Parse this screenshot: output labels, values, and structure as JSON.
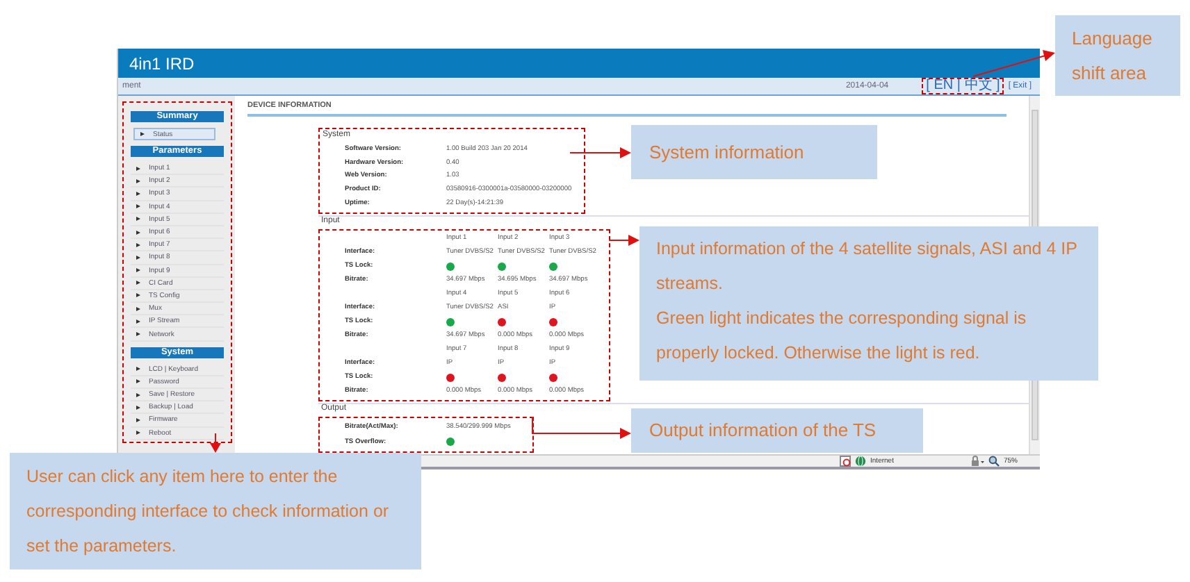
{
  "window": {
    "title": "4in1 IRD"
  },
  "nav_bar": {
    "breadcrumb": "ment",
    "date": "2014-04-04",
    "language_switch": {
      "label": "[ EN | 中文 ]",
      "highlighted": true
    },
    "exit": "[ Exit ]"
  },
  "sidebar": {
    "groups": [
      {
        "title": "Summary",
        "items": [
          {
            "label": "Status",
            "selected": true
          }
        ]
      },
      {
        "title": "Parameters",
        "items": [
          {
            "label": "Input 1",
            "selected": false
          },
          {
            "label": "Input 2",
            "selected": false
          },
          {
            "label": "Input 3",
            "selected": false
          },
          {
            "label": "Input 4",
            "selected": false
          },
          {
            "label": "Input 5",
            "selected": false
          },
          {
            "label": "Input 6",
            "selected": false
          },
          {
            "label": "Input 7",
            "selected": false
          },
          {
            "label": "Input 8",
            "selected": false
          },
          {
            "label": "Input 9",
            "selected": false
          },
          {
            "label": "CI Card",
            "selected": false
          },
          {
            "label": "TS Config",
            "selected": false
          },
          {
            "label": "Mux",
            "selected": false
          },
          {
            "label": "IP Stream",
            "selected": false
          },
          {
            "label": "Network",
            "selected": false
          }
        ]
      },
      {
        "title": "System",
        "items": [
          {
            "label": "LCD | Keyboard",
            "selected": false
          },
          {
            "label": "Password",
            "selected": false
          },
          {
            "label": "Save | Restore",
            "selected": false
          },
          {
            "label": "Backup | Load",
            "selected": false
          },
          {
            "label": "Firmware",
            "selected": false
          },
          {
            "label": "Reboot",
            "selected": false
          }
        ]
      }
    ]
  },
  "content": {
    "title": "DEVICE INFORMATION",
    "system": {
      "title": "System",
      "rows": [
        {
          "label": "Software Version:",
          "value": "1.00 Build 203 Jan 20 2014"
        },
        {
          "label": "Hardware Version:",
          "value": "0.40"
        },
        {
          "label": "Web Version:",
          "value": "1.03"
        },
        {
          "label": "Product ID:",
          "value": "03580916-0300001a-03580000-03200000"
        },
        {
          "label": "Uptime:",
          "value": "22 Day(s)-14:21:39"
        }
      ]
    },
    "input": {
      "title": "Input",
      "groups": [
        {
          "labels": [
            "Interface:",
            "TS Lock:",
            "Bitrate:"
          ],
          "inputs": [
            {
              "name": "Input 1",
              "interface": "Tuner DVBS/S2",
              "locked": true,
              "bitrate": "34.697 Mbps"
            },
            {
              "name": "Input 2",
              "interface": "Tuner DVBS/S2",
              "locked": true,
              "bitrate": "34.695 Mbps"
            },
            {
              "name": "Input 3",
              "interface": "Tuner DVBS/S2",
              "locked": true,
              "bitrate": "34.697 Mbps"
            }
          ]
        },
        {
          "labels": [
            "Interface:",
            "TS Lock:",
            "Bitrate:"
          ],
          "inputs": [
            {
              "name": "Input 4",
              "interface": "Tuner DVBS/S2",
              "locked": true,
              "bitrate": "34.697 Mbps"
            },
            {
              "name": "Input 5",
              "interface": "ASI",
              "locked": false,
              "bitrate": "0.000 Mbps"
            },
            {
              "name": "Input 6",
              "interface": "IP",
              "locked": false,
              "bitrate": "0.000 Mbps"
            }
          ]
        },
        {
          "labels": [
            "Interface:",
            "TS Lock:",
            "Bitrate:"
          ],
          "inputs": [
            {
              "name": "Input 7",
              "interface": "IP",
              "locked": false,
              "bitrate": "0.000 Mbps"
            },
            {
              "name": "Input 8",
              "interface": "IP",
              "locked": false,
              "bitrate": "0.000 Mbps"
            },
            {
              "name": "Input 9",
              "interface": "IP",
              "locked": false,
              "bitrate": "0.000 Mbps"
            }
          ]
        }
      ]
    },
    "output": {
      "title": "Output",
      "rows": [
        {
          "kind": "text",
          "label": "Bitrate(Act/Max):",
          "value": "38.540/299.999 Mbps"
        },
        {
          "kind": "light",
          "label": "TS Overflow:",
          "ok": true
        }
      ]
    }
  },
  "status_bar": {
    "zone": "Internet",
    "zoom": "75%"
  },
  "callouts": [
    {
      "paragraphs": [
        "Language shift area"
      ]
    },
    {
      "paragraphs": [
        "System information"
      ]
    },
    {
      "paragraphs": [
        "Input information of the 4 satellite signals, ASI and 4 IP streams.",
        "Green light indicates the corresponding signal is properly locked. Otherwise the light is red."
      ]
    },
    {
      "paragraphs": [
        "Output information of the TS"
      ]
    },
    {
      "paragraphs": [
        "User can click any item here to enter the corresponding interface to check information or set the parameters."
      ]
    }
  ]
}
